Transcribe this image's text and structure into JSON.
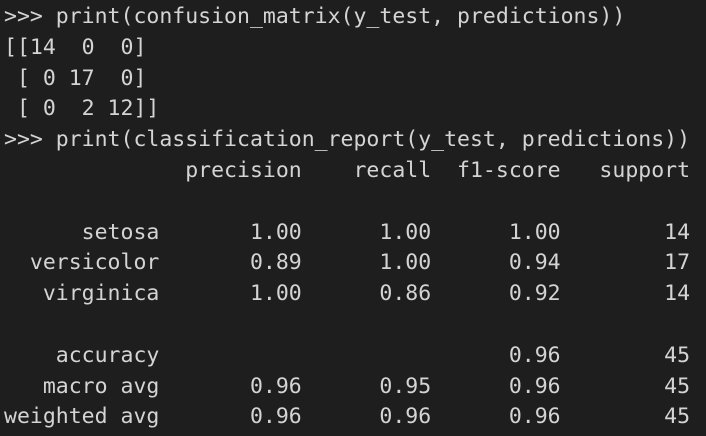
{
  "terminal": {
    "lines": [
      ">>> print(confusion_matrix(y_test, predictions))",
      "[[14  0  0]",
      " [ 0 17  0]",
      " [ 0  2 12]]",
      ">>> print(classification_report(y_test, predictions))",
      "              precision    recall  f1-score   support",
      "",
      "      setosa       1.00      1.00      1.00        14",
      "  versicolor       0.89      1.00      0.94        17",
      "   virginica       1.00      0.86      0.92        14",
      "",
      "    accuracy                           0.96        45",
      "   macro avg       0.96      0.95      0.96        45",
      "weighted avg       0.96      0.96      0.96        45"
    ]
  }
}
